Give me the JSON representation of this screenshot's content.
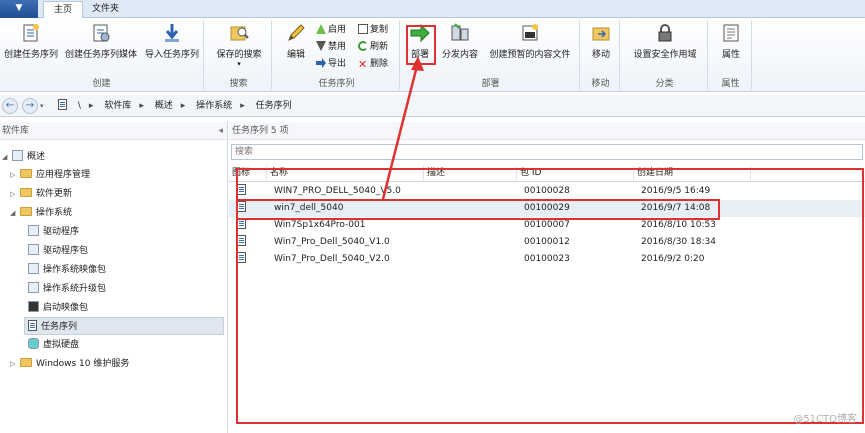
{
  "tabs": {
    "menu_glyph": "▼",
    "home": "主页",
    "file": "文件夹"
  },
  "ribbon": {
    "groups": [
      {
        "label": "创建",
        "buttons": [
          "创建任务序列",
          "创建任务序列媒体",
          "导入任务序列"
        ]
      },
      {
        "label": "搜索",
        "buttons": [
          "保存的搜索"
        ]
      },
      {
        "label": "任务序列",
        "buttons": [
          "编辑"
        ],
        "small": [
          "启用",
          "禁用",
          "导出",
          "复制",
          "刷新",
          "删除"
        ]
      },
      {
        "label": "部署",
        "buttons": [
          "部署",
          "分发内容",
          "创建预暂的内容文件"
        ]
      },
      {
        "label": "移动",
        "buttons": [
          "移动"
        ]
      },
      {
        "label": "分类",
        "buttons": [
          "设置安全作用域"
        ]
      },
      {
        "label": "属性",
        "buttons": [
          "属性"
        ]
      }
    ]
  },
  "address": {
    "back": "←",
    "forward": "→",
    "crumbs": [
      "\\",
      "软件库",
      "概述",
      "操作系统",
      "任务序列"
    ],
    "separator": "▸"
  },
  "left": {
    "header": "软件库",
    "items": [
      "概述",
      "应用程序管理",
      "软件更新",
      "操作系统",
      "驱动程序",
      "驱动程序包",
      "操作系统映像包",
      "操作系统升级包",
      "启动映像包",
      "任务序列",
      "虚拟硬盘",
      "Windows 10 维护服务"
    ]
  },
  "right": {
    "title": "任务序列 5 项",
    "search_placeholder": "搜索",
    "columns": [
      "图标",
      "名称",
      "描述",
      "包 ID",
      "创建日期"
    ],
    "rows": [
      {
        "name": "WIN7_PRO_DELL_5040_V5.0",
        "desc": "",
        "id": "00100028",
        "date": "2016/9/5 16:49"
      },
      {
        "name": "win7_dell_5040",
        "desc": "",
        "id": "00100029",
        "date": "2016/9/7 14:08"
      },
      {
        "name": "Win7Sp1x64Pro-001",
        "desc": "",
        "id": "00100007",
        "date": "2016/8/10 10:53"
      },
      {
        "name": "Win7_Pro_Dell_5040_V1.0",
        "desc": "",
        "id": "00100012",
        "date": "2016/8/30 18:34"
      },
      {
        "name": "Win7_Pro_Dell_5040_V2.0",
        "desc": "",
        "id": "00100023",
        "date": "2016/9/2 0:20"
      }
    ]
  },
  "watermark": "@51CTO博客",
  "colors": {
    "annotation": "#e03131",
    "accent": "#2f63ad"
  }
}
